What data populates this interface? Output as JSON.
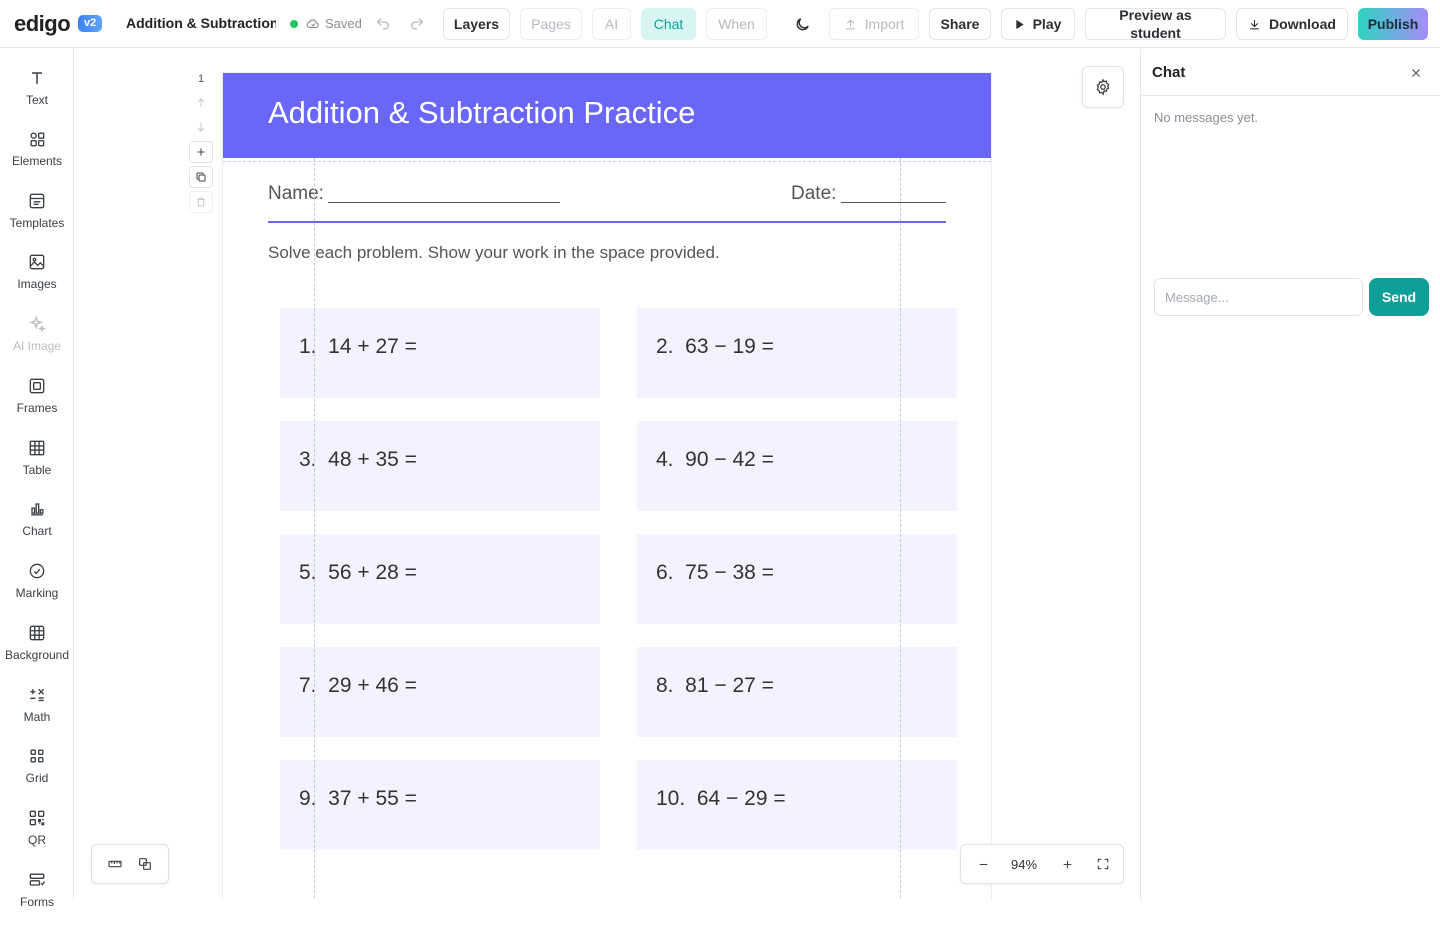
{
  "app": {
    "logo": "edigo",
    "version_badge": "v2",
    "doc_title": "Addition & Subtraction I",
    "save_status": "Saved"
  },
  "toolbar": {
    "layers": "Layers",
    "pages": "Pages",
    "ai": "AI",
    "chat": "Chat",
    "when": "When",
    "import": "Import",
    "share": "Share",
    "play": "Play",
    "preview": "Preview as student",
    "download": "Download",
    "publish": "Publish",
    "active_tab": "Chat"
  },
  "sidebar": {
    "tools": [
      {
        "label": "Text",
        "icon": "text-icon",
        "enabled": true
      },
      {
        "label": "Elements",
        "icon": "elements-icon",
        "enabled": true
      },
      {
        "label": "Templates",
        "icon": "templates-icon",
        "enabled": true
      },
      {
        "label": "Images",
        "icon": "image-icon",
        "enabled": true
      },
      {
        "label": "AI Image",
        "icon": "sparkle-icon",
        "enabled": false
      },
      {
        "label": "Frames",
        "icon": "frame-icon",
        "enabled": true
      },
      {
        "label": "Table",
        "icon": "table-icon",
        "enabled": true
      },
      {
        "label": "Chart",
        "icon": "chart-icon",
        "enabled": true
      },
      {
        "label": "Marking",
        "icon": "check-circle-icon",
        "enabled": true
      },
      {
        "label": "Background",
        "icon": "grid-background-icon",
        "enabled": true
      },
      {
        "label": "Math",
        "icon": "math-icon",
        "enabled": true
      },
      {
        "label": "Grid",
        "icon": "grid-icon",
        "enabled": true
      },
      {
        "label": "QR",
        "icon": "qr-icon",
        "enabled": true
      },
      {
        "label": "Forms",
        "icon": "forms-icon",
        "enabled": true
      }
    ]
  },
  "canvas": {
    "page_number": "1",
    "zoom": "94%"
  },
  "worksheet": {
    "title": "Addition & Subtraction Practice",
    "name_label": "Name:",
    "date_label": "Date:",
    "instructions": "Solve each problem. Show your work in the space provided.",
    "problems": [
      "1.  14 + 27 =",
      "2.  63 − 19 =",
      "3.  48 + 35 =",
      "4.  90 − 42 =",
      "5.  56 + 28 =",
      "6.  75 − 38 =",
      "7.  29 + 46 =",
      "8.  81 − 27 =",
      "9.  37 + 55 =",
      "10.  64 − 29 ="
    ],
    "header_color": "#6a67f8",
    "problem_bg": "#f3f2ff"
  },
  "chat": {
    "title": "Chat",
    "empty_text": "No messages yet.",
    "input_placeholder": "Message...",
    "send_label": "Send",
    "accent": "#0e9f98"
  }
}
